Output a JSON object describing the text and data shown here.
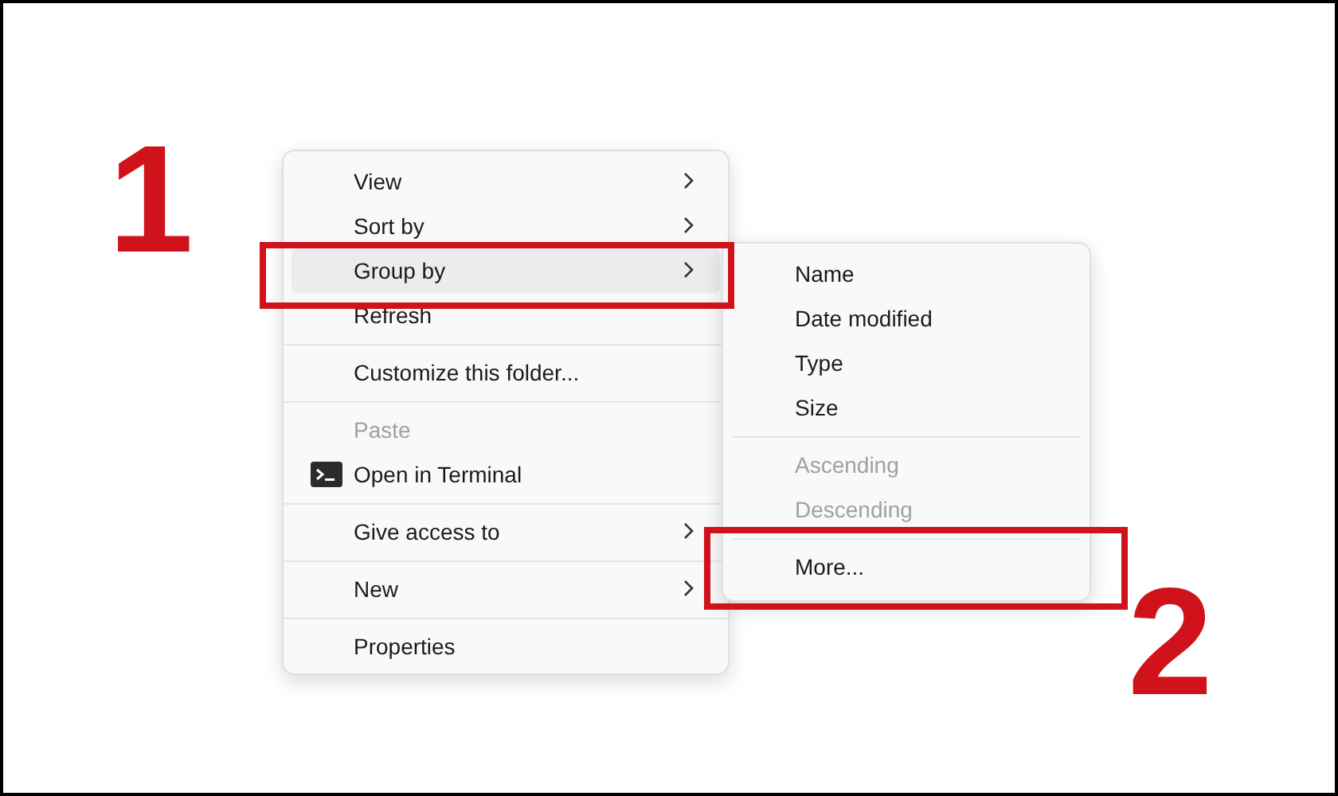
{
  "menu": {
    "items": [
      {
        "kind": "item",
        "label": "View",
        "submenu": true,
        "disabled": false,
        "selected": false
      },
      {
        "kind": "item",
        "label": "Sort by",
        "submenu": true,
        "disabled": false,
        "selected": false
      },
      {
        "kind": "item",
        "label": "Group by",
        "submenu": true,
        "disabled": false,
        "selected": true
      },
      {
        "kind": "item",
        "label": "Refresh",
        "submenu": false,
        "disabled": false,
        "selected": false
      },
      {
        "kind": "separator"
      },
      {
        "kind": "item",
        "label": "Customize this folder...",
        "submenu": false,
        "disabled": false,
        "selected": false
      },
      {
        "kind": "separator"
      },
      {
        "kind": "item",
        "label": "Paste",
        "submenu": false,
        "disabled": true,
        "selected": false
      },
      {
        "kind": "terminal",
        "label": "Open in Terminal",
        "submenu": false,
        "disabled": false,
        "selected": false
      },
      {
        "kind": "separator"
      },
      {
        "kind": "item",
        "label": "Give access to",
        "submenu": true,
        "disabled": false,
        "selected": false
      },
      {
        "kind": "separator"
      },
      {
        "kind": "item",
        "label": "New",
        "submenu": true,
        "disabled": false,
        "selected": false
      },
      {
        "kind": "separator"
      },
      {
        "kind": "item",
        "label": "Properties",
        "submenu": false,
        "disabled": false,
        "selected": false
      }
    ]
  },
  "submenu": {
    "items": [
      {
        "kind": "item",
        "label": "Name",
        "disabled": false
      },
      {
        "kind": "item",
        "label": "Date modified",
        "disabled": false
      },
      {
        "kind": "item",
        "label": "Type",
        "disabled": false
      },
      {
        "kind": "item",
        "label": "Size",
        "disabled": false
      },
      {
        "kind": "separator"
      },
      {
        "kind": "item",
        "label": "Ascending",
        "disabled": true
      },
      {
        "kind": "item",
        "label": "Descending",
        "disabled": true
      },
      {
        "kind": "separator"
      },
      {
        "kind": "item",
        "label": "More...",
        "disabled": false
      }
    ]
  },
  "annotations": [
    {
      "label": "1"
    },
    {
      "label": "2"
    }
  ]
}
